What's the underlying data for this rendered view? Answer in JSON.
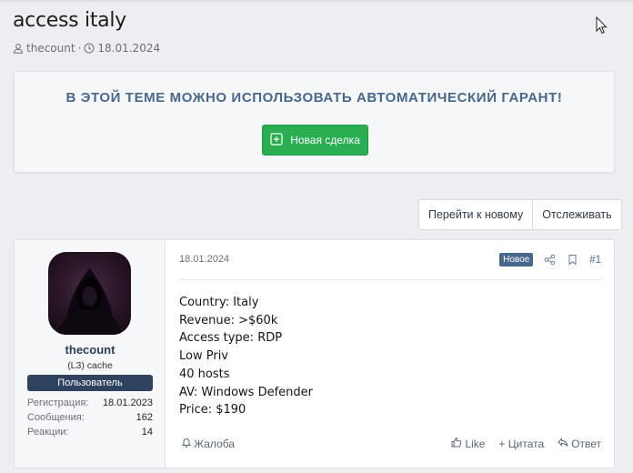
{
  "thread": {
    "title": "access italy",
    "author": "thecount",
    "separator": "·",
    "date": "18.01.2024"
  },
  "notice": {
    "text": "В ЭТОЙ ТЕМЕ МОЖНО ИСПОЛЬЗОВАТЬ АВТОМАТИЧЕСКИЙ ГАРАНТ!",
    "button_label": "Новая сделка",
    "button_color": "#2aae52",
    "text_color": "#47678d"
  },
  "thread_actions": {
    "goto_new": "Перейти к новому",
    "watch": "Отслеживать"
  },
  "post": {
    "user": {
      "name": "thecount",
      "title": "(L3) cache",
      "banner": "Пользователь",
      "stats": [
        {
          "label": "Регистрация:",
          "value": "18.01.2023"
        },
        {
          "label": "Сообщения:",
          "value": "162"
        },
        {
          "label": "Реакции:",
          "value": "14"
        }
      ]
    },
    "date": "18.01.2024",
    "badge": "Новое",
    "number": "#1",
    "body_lines": [
      "Country: Italy",
      "Revenue: >$60k",
      "Access type: RDP",
      "Low Priv",
      "40 hosts",
      "AV: Windows Defender",
      "Price: $190"
    ],
    "footer": {
      "report": "Жалоба",
      "like": "Like",
      "quote": "+ Цитата",
      "reply": "Ответ"
    }
  },
  "icons": {
    "author": "user-icon",
    "date": "clock-icon",
    "deal": "plus-square-icon",
    "share": "share-icon",
    "bookmark": "bookmark-icon",
    "report": "bell-icon",
    "like": "thumbs-up-icon",
    "reply": "reply-icon"
  }
}
